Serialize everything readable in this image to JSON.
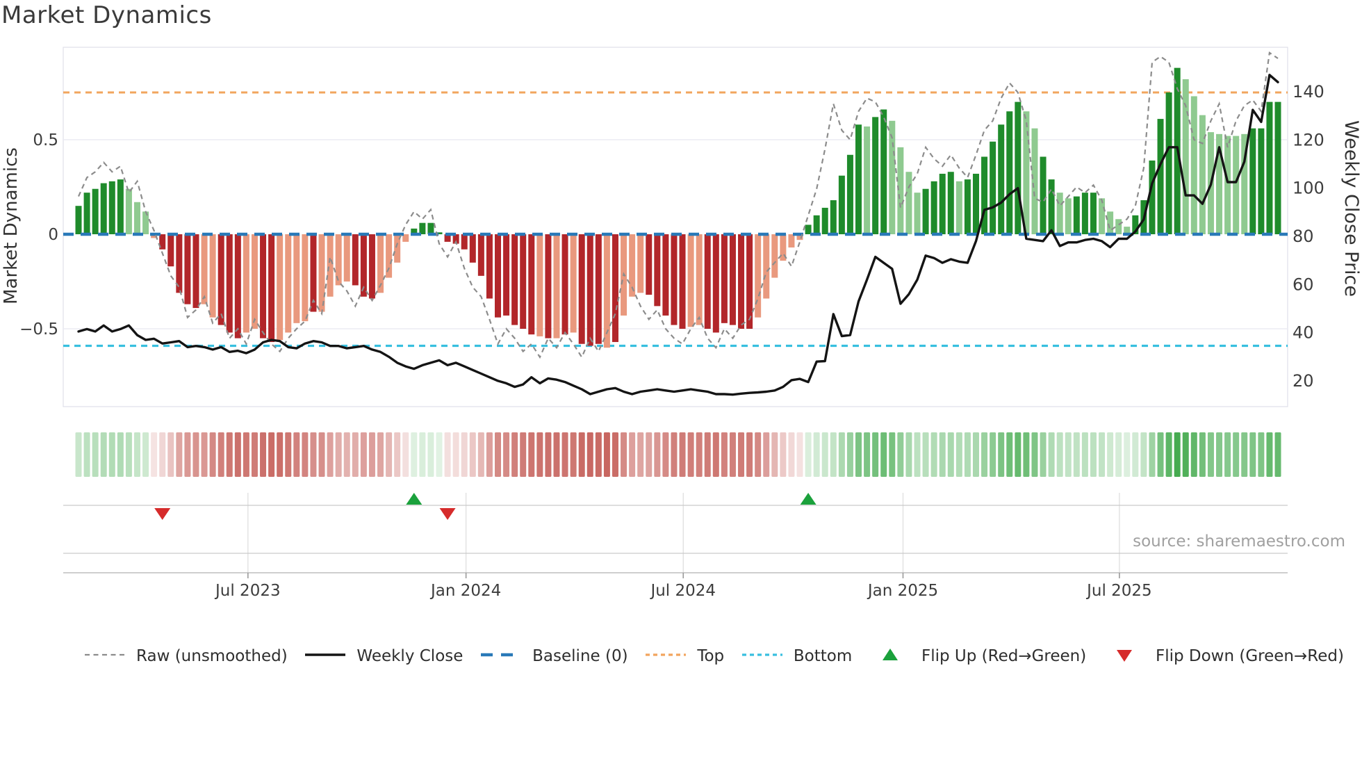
{
  "title": "Market Dynamics",
  "source_text": "source: sharemaestro.com",
  "left_axis": {
    "label": "Market Dynamics",
    "tick_labels": [
      "0.5",
      "0",
      "−0.5"
    ],
    "tick_values": [
      0.5,
      0,
      -0.5
    ]
  },
  "right_axis": {
    "label": "Weekly Close Price",
    "tick_labels": [
      "140",
      "120",
      "100",
      "80",
      "60",
      "40",
      "20"
    ],
    "tick_values": [
      140,
      120,
      100,
      80,
      60,
      40,
      20
    ]
  },
  "x_axis": {
    "tick_labels": [
      "Jul 2023",
      "Jan 2024",
      "Jul 2024",
      "Jan 2025",
      "Jul 2025"
    ],
    "tick_week_index": [
      20.2,
      46.2,
      72.1,
      98.3,
      124.1
    ]
  },
  "legend": {
    "items": [
      {
        "label": "Raw (unsmoothed)",
        "swatch": "dashed-line",
        "color": "#8c8c8c"
      },
      {
        "label": "Weekly Close",
        "swatch": "solid-line",
        "color": "#141414"
      },
      {
        "label": "Baseline (0)",
        "swatch": "dashed-thick",
        "color": "#2979b8"
      },
      {
        "label": "Top",
        "swatch": "dotted-line",
        "color": "#f2a55e"
      },
      {
        "label": "Bottom",
        "swatch": "dotted-line",
        "color": "#38bfdf"
      },
      {
        "label": "Flip Up (Red→Green)",
        "swatch": "triangle-up",
        "color": "#1ba13c"
      },
      {
        "label": "Flip Down (Green→Red)",
        "swatch": "triangle-down",
        "color": "#d62b2b"
      }
    ]
  },
  "colors": {
    "bar_pos": "#1f8b2b",
    "bar_pos_soft": "#8fca90",
    "bar_neg": "#b2262a",
    "bar_neg_soft": "#e9997e",
    "baseline": "#2979b8",
    "top_line": "#f2a55e",
    "bottom_line": "#38bfdf",
    "raw_line": "#8c8c8c",
    "price_line": "#141414",
    "flip_up": "#1ba13c",
    "flip_down": "#d62b2b",
    "heat_pos": "#46ab50",
    "heat_neg": "#c6625c",
    "grid": "#ebebf3",
    "frame": "#dfe0e8",
    "panel_line": "#c9c9c9",
    "tick_text": "#3d3d3d"
  },
  "chart_data": {
    "type": "bar+line",
    "n_weeks": 144,
    "baseline": 0,
    "top_threshold": 0.75,
    "bottom_threshold": -0.59,
    "left_ylim": [
      -0.91,
      0.99
    ],
    "right_ylim": [
      9,
      158
    ],
    "flip_up_weeks": [
      40,
      87
    ],
    "flip_down_weeks": [
      10,
      44
    ],
    "series": [
      {
        "name": "Oscillator (smoothed bars)",
        "type": "bar",
        "axis": "left",
        "values": [
          0.15,
          0.22,
          0.24,
          0.27,
          0.28,
          0.29,
          0.24,
          0.17,
          0.12,
          -0.02,
          -0.08,
          -0.17,
          -0.31,
          -0.37,
          -0.39,
          -0.37,
          -0.44,
          -0.48,
          -0.52,
          -0.55,
          -0.52,
          -0.5,
          -0.55,
          -0.57,
          -0.56,
          -0.52,
          -0.47,
          -0.46,
          -0.41,
          -0.41,
          -0.33,
          -0.27,
          -0.25,
          -0.27,
          -0.33,
          -0.34,
          -0.31,
          -0.23,
          -0.15,
          -0.04,
          0.03,
          0.06,
          0.06,
          0.01,
          -0.04,
          -0.05,
          -0.08,
          -0.15,
          -0.22,
          -0.34,
          -0.44,
          -0.43,
          -0.48,
          -0.5,
          -0.53,
          -0.54,
          -0.55,
          -0.55,
          -0.53,
          -0.52,
          -0.58,
          -0.59,
          -0.58,
          -0.6,
          -0.57,
          -0.43,
          -0.33,
          -0.31,
          -0.32,
          -0.38,
          -0.43,
          -0.48,
          -0.5,
          -0.49,
          -0.48,
          -0.5,
          -0.52,
          -0.47,
          -0.48,
          -0.5,
          -0.5,
          -0.44,
          -0.34,
          -0.23,
          -0.14,
          -0.07,
          -0.03,
          0.05,
          0.1,
          0.14,
          0.18,
          0.31,
          0.42,
          0.58,
          0.57,
          0.62,
          0.66,
          0.6,
          0.46,
          0.33,
          0.22,
          0.24,
          0.28,
          0.32,
          0.33,
          0.28,
          0.29,
          0.32,
          0.41,
          0.49,
          0.58,
          0.65,
          0.7,
          0.65,
          0.56,
          0.41,
          0.29,
          0.22,
          0.19,
          0.2,
          0.22,
          0.22,
          0.19,
          0.12,
          0.08,
          0.04,
          0.1,
          0.18,
          0.39,
          0.61,
          0.75,
          0.88,
          0.82,
          0.73,
          0.63,
          0.54,
          0.53,
          0.52,
          0.52,
          0.53,
          0.56,
          0.56,
          0.7,
          0.7
        ]
      },
      {
        "name": "soft_bar_flags",
        "type": "flag",
        "values": [
          0,
          0,
          0,
          0,
          0,
          0,
          1,
          1,
          1,
          1,
          0,
          0,
          0,
          0,
          0,
          1,
          1,
          0,
          0,
          0,
          1,
          1,
          0,
          0,
          1,
          1,
          1,
          1,
          0,
          1,
          1,
          1,
          1,
          0,
          0,
          0,
          1,
          1,
          1,
          1,
          0,
          0,
          0,
          0,
          0,
          0,
          0,
          0,
          0,
          0,
          0,
          0,
          0,
          0,
          0,
          1,
          0,
          1,
          0,
          1,
          0,
          0,
          0,
          1,
          0,
          1,
          1,
          1,
          0,
          0,
          0,
          0,
          0,
          1,
          1,
          0,
          0,
          0,
          0,
          0,
          0,
          1,
          1,
          1,
          1,
          1,
          1,
          0,
          0,
          0,
          0,
          0,
          0,
          0,
          1,
          0,
          0,
          1,
          1,
          1,
          1,
          0,
          0,
          0,
          0,
          1,
          0,
          0,
          0,
          0,
          0,
          0,
          0,
          1,
          1,
          0,
          0,
          1,
          1,
          0,
          0,
          0,
          1,
          1,
          1,
          1,
          0,
          0,
          0,
          0,
          0,
          0,
          1,
          1,
          1,
          1,
          1,
          1,
          1,
          1,
          0,
          0,
          0,
          0
        ]
      },
      {
        "name": "Raw (unsmoothed)",
        "type": "line",
        "axis": "left",
        "values": [
          0.2,
          0.3,
          0.33,
          0.38,
          0.33,
          0.36,
          0.22,
          0.28,
          0.12,
          0.02,
          -0.1,
          -0.22,
          -0.28,
          -0.44,
          -0.4,
          -0.33,
          -0.47,
          -0.42,
          -0.55,
          -0.5,
          -0.58,
          -0.45,
          -0.52,
          -0.58,
          -0.62,
          -0.55,
          -0.5,
          -0.46,
          -0.35,
          -0.42,
          -0.12,
          -0.25,
          -0.3,
          -0.38,
          -0.28,
          -0.35,
          -0.27,
          -0.18,
          -0.05,
          0.05,
          0.12,
          0.08,
          0.13,
          -0.05,
          -0.12,
          -0.04,
          -0.18,
          -0.28,
          -0.33,
          -0.45,
          -0.58,
          -0.5,
          -0.55,
          -0.62,
          -0.58,
          -0.65,
          -0.55,
          -0.6,
          -0.52,
          -0.58,
          -0.65,
          -0.55,
          -0.62,
          -0.52,
          -0.42,
          -0.21,
          -0.28,
          -0.38,
          -0.45,
          -0.4,
          -0.5,
          -0.55,
          -0.58,
          -0.5,
          -0.44,
          -0.55,
          -0.6,
          -0.5,
          -0.55,
          -0.48,
          -0.45,
          -0.34,
          -0.2,
          -0.15,
          -0.1,
          -0.17,
          -0.04,
          0.1,
          0.24,
          0.45,
          0.69,
          0.55,
          0.5,
          0.65,
          0.72,
          0.7,
          0.62,
          0.51,
          0.14,
          0.25,
          0.32,
          0.46,
          0.4,
          0.36,
          0.42,
          0.35,
          0.3,
          0.42,
          0.55,
          0.6,
          0.72,
          0.8,
          0.75,
          0.6,
          0.19,
          0.17,
          0.24,
          0.15,
          0.2,
          0.25,
          0.22,
          0.26,
          0.18,
          0.02,
          0.05,
          0.08,
          0.15,
          0.35,
          0.91,
          0.94,
          0.91,
          0.77,
          0.68,
          0.5,
          0.48,
          0.6,
          0.69,
          0.46,
          0.6,
          0.68,
          0.71,
          0.65,
          0.96,
          0.93
        ]
      },
      {
        "name": "Weekly Close",
        "type": "line",
        "axis": "right",
        "values": [
          40.5,
          41.5,
          40.5,
          43.0,
          40.5,
          41.5,
          43.0,
          39.0,
          37.0,
          37.5,
          35.5,
          36.0,
          36.5,
          34.0,
          34.5,
          34.0,
          33.0,
          34.0,
          32.0,
          32.5,
          31.5,
          33.0,
          36.0,
          37.0,
          36.5,
          34.0,
          33.5,
          35.5,
          36.5,
          36.0,
          34.5,
          34.5,
          33.5,
          34.0,
          34.5,
          33.0,
          32.0,
          30.0,
          27.5,
          26.0,
          25.0,
          26.5,
          27.5,
          28.5,
          26.5,
          27.5,
          26.0,
          24.5,
          23.0,
          21.5,
          20.0,
          19.0,
          17.5,
          18.5,
          21.5,
          19.0,
          21.0,
          20.5,
          19.5,
          18.0,
          16.5,
          14.5,
          15.5,
          16.5,
          17.0,
          15.5,
          14.5,
          15.5,
          16.0,
          16.5,
          16.0,
          15.5,
          16.0,
          16.5,
          16.0,
          15.5,
          14.5,
          14.5,
          14.3,
          14.7,
          15.0,
          15.2,
          15.5,
          16.0,
          17.5,
          20.3,
          20.8,
          19.5,
          28.0,
          28.2,
          47.7,
          38.6,
          39.0,
          53.0,
          62.0,
          71.5,
          69.0,
          66.5,
          52.0,
          56.0,
          62.0,
          72.0,
          71.0,
          69.0,
          70.5,
          69.5,
          69.0,
          78.0,
          91.0,
          92.0,
          94.0,
          97.5,
          100.0,
          79.0,
          78.5,
          78.0,
          82.5,
          76.0,
          77.5,
          77.5,
          78.5,
          79.0,
          78.0,
          75.5,
          79.0,
          79.0,
          82.0,
          87.0,
          102.0,
          110.0,
          117.0,
          117.0,
          97.0,
          97.0,
          93.5,
          101.5,
          117.0,
          102.5,
          102.5,
          111.0,
          132.5,
          127.5,
          147.0,
          144.0
        ]
      }
    ]
  }
}
